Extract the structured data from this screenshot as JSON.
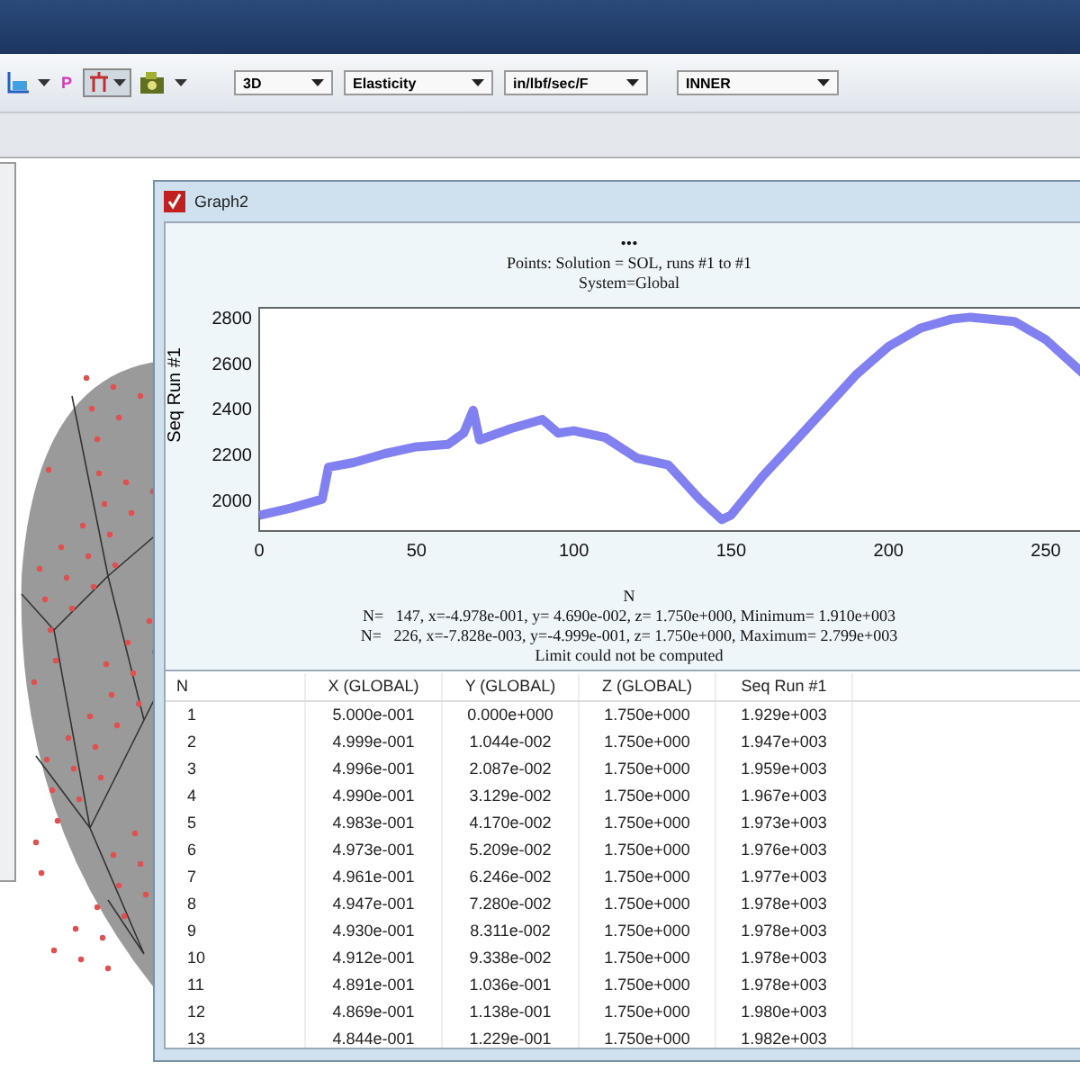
{
  "toolbar": {
    "p_label": "P",
    "dropdowns": [
      {
        "value": "3D"
      },
      {
        "value": "Elasticity"
      },
      {
        "value": "in/lbf/sec/F"
      },
      {
        "value": "INNER"
      }
    ]
  },
  "graph_window": {
    "title": "Graph2",
    "chart_header": [
      "•••",
      "Points: Solution = SOL, runs #1 to #1",
      "System=Global"
    ],
    "chart_data": {
      "type": "line",
      "xlabel": "N",
      "ylabel": "Seq Run #1",
      "xlim": [
        0,
        262
      ],
      "ylim": [
        1860,
        2840
      ],
      "xticks": [
        0,
        50,
        100,
        150,
        200,
        250
      ],
      "yticks": [
        2000,
        2200,
        2400,
        2600,
        2800
      ],
      "x": [
        0,
        10,
        20,
        22,
        30,
        40,
        50,
        60,
        65,
        68,
        70,
        80,
        90,
        95,
        100,
        110,
        120,
        130,
        140,
        147,
        150,
        160,
        170,
        180,
        190,
        200,
        210,
        220,
        226,
        240,
        250,
        262
      ],
      "series": [
        {
          "color": "#8080f0",
          "values": [
            1929,
            1960,
            2000,
            2140,
            2160,
            2200,
            2230,
            2240,
            2290,
            2390,
            2260,
            2310,
            2350,
            2290,
            2300,
            2270,
            2180,
            2150,
            2000,
            1910,
            1930,
            2100,
            2250,
            2400,
            2550,
            2670,
            2750,
            2790,
            2799,
            2780,
            2700,
            2550
          ]
        }
      ]
    },
    "chart_footer": [
      "N=   147, x=-4.978e-001, y= 4.690e-002, z= 1.750e+000, Minimum= 1.910e+003",
      "N=   226, x=-7.828e-003, y=-4.999e-001, z= 1.750e+000, Maximum= 2.799e+003",
      "Limit could not be computed"
    ],
    "table": {
      "columns": [
        "N",
        "X (GLOBAL)",
        "Y (GLOBAL)",
        "Z (GLOBAL)",
        "Seq Run #1"
      ],
      "rows": [
        [
          "1",
          "5.000e-001",
          "0.000e+000",
          "1.750e+000",
          "1.929e+003"
        ],
        [
          "2",
          "4.999e-001",
          "1.044e-002",
          "1.750e+000",
          "1.947e+003"
        ],
        [
          "3",
          "4.996e-001",
          "2.087e-002",
          "1.750e+000",
          "1.959e+003"
        ],
        [
          "4",
          "4.990e-001",
          "3.129e-002",
          "1.750e+000",
          "1.967e+003"
        ],
        [
          "5",
          "4.983e-001",
          "4.170e-002",
          "1.750e+000",
          "1.973e+003"
        ],
        [
          "6",
          "4.973e-001",
          "5.209e-002",
          "1.750e+000",
          "1.976e+003"
        ],
        [
          "7",
          "4.961e-001",
          "6.246e-002",
          "1.750e+000",
          "1.977e+003"
        ],
        [
          "8",
          "4.947e-001",
          "7.280e-002",
          "1.750e+000",
          "1.978e+003"
        ],
        [
          "9",
          "4.930e-001",
          "8.311e-002",
          "1.750e+000",
          "1.978e+003"
        ],
        [
          "10",
          "4.912e-001",
          "9.338e-002",
          "1.750e+000",
          "1.978e+003"
        ],
        [
          "11",
          "4.891e-001",
          "1.036e-001",
          "1.750e+000",
          "1.978e+003"
        ],
        [
          "12",
          "4.869e-001",
          "1.138e-001",
          "1.750e+000",
          "1.980e+003"
        ],
        [
          "13",
          "4.844e-001",
          "1.229e-001",
          "1.750e+000",
          "1.982e+003"
        ]
      ]
    }
  }
}
